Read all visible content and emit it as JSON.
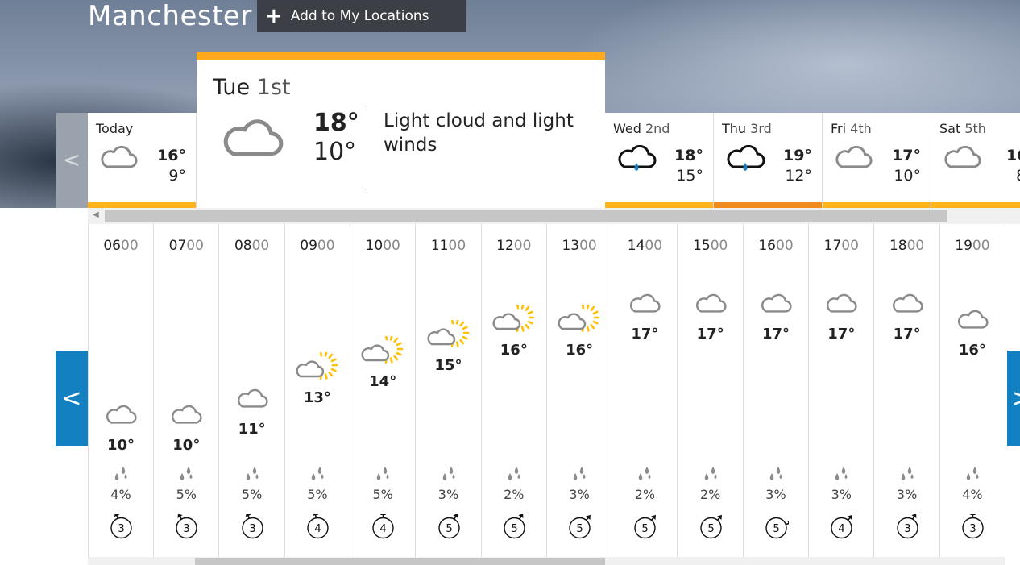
{
  "location": {
    "name": "Manchester",
    "add_label": "Add to My Locations",
    "add_icon": "plus-icon"
  },
  "colors": {
    "accent": "#ffb41e",
    "accent_dark": "#f08c1e",
    "nav": "#1380c2",
    "sun": "#ffc107",
    "rain": "#1c7bbf"
  },
  "selected_day": {
    "day": "Tue",
    "date": "1st",
    "high": "18°",
    "low": "10°",
    "description": "Light cloud and light winds",
    "icon": "cloud-icon"
  },
  "days": [
    {
      "day": "Today",
      "date": "",
      "high": "16°",
      "low": "9°",
      "icon": "cloud-icon"
    },
    {
      "day": "Wed",
      "date": "2nd",
      "high": "18°",
      "low": "15°",
      "icon": "rain-cloud-icon"
    },
    {
      "day": "Thu",
      "date": "3rd",
      "high": "19°",
      "low": "12°",
      "icon": "rain-cloud-icon"
    },
    {
      "day": "Fri",
      "date": "4th",
      "high": "17°",
      "low": "10°",
      "icon": "cloud-icon"
    },
    {
      "day": "Sat",
      "date": "5th",
      "high": "16",
      "low": "8",
      "icon": "cloud-icon"
    }
  ],
  "hours": [
    {
      "hh": "06",
      "mm": "00",
      "icon": "cloud-icon",
      "temp": "10°",
      "rain": "4%",
      "wind": "3",
      "wind_deg": 340
    },
    {
      "hh": "07",
      "mm": "00",
      "icon": "cloud-icon",
      "temp": "10°",
      "rain": "5%",
      "wind": "3",
      "wind_deg": 330
    },
    {
      "hh": "08",
      "mm": "00",
      "icon": "cloud-icon",
      "temp": "11°",
      "rain": "5%",
      "wind": "3",
      "wind_deg": 340
    },
    {
      "hh": "09",
      "mm": "00",
      "icon": "sun-cloud-icon",
      "temp": "13°",
      "rain": "5%",
      "wind": "4",
      "wind_deg": 350
    },
    {
      "hh": "10",
      "mm": "00",
      "icon": "sun-cloud-icon",
      "temp": "14°",
      "rain": "5%",
      "wind": "4",
      "wind_deg": 0
    },
    {
      "hh": "11",
      "mm": "00",
      "icon": "sun-cloud-icon",
      "temp": "15°",
      "rain": "3%",
      "wind": "5",
      "wind_deg": 30
    },
    {
      "hh": "12",
      "mm": "00",
      "icon": "sun-cloud-icon",
      "temp": "16°",
      "rain": "2%",
      "wind": "5",
      "wind_deg": 30
    },
    {
      "hh": "13",
      "mm": "00",
      "icon": "sun-cloud-icon",
      "temp": "16°",
      "rain": "3%",
      "wind": "5",
      "wind_deg": 40
    },
    {
      "hh": "14",
      "mm": "00",
      "icon": "cloud-icon",
      "temp": "17°",
      "rain": "2%",
      "wind": "5",
      "wind_deg": 40
    },
    {
      "hh": "15",
      "mm": "00",
      "icon": "cloud-icon",
      "temp": "17°",
      "rain": "2%",
      "wind": "5",
      "wind_deg": 40
    },
    {
      "hh": "16",
      "mm": "00",
      "icon": "cloud-icon",
      "temp": "17°",
      "rain": "3%",
      "wind": "5",
      "wind_deg": 70
    },
    {
      "hh": "17",
      "mm": "00",
      "icon": "cloud-icon",
      "temp": "17°",
      "rain": "3%",
      "wind": "4",
      "wind_deg": 40
    },
    {
      "hh": "18",
      "mm": "00",
      "icon": "cloud-icon",
      "temp": "17°",
      "rain": "3%",
      "wind": "3",
      "wind_deg": 30
    },
    {
      "hh": "19",
      "mm": "00",
      "icon": "cloud-icon",
      "temp": "16°",
      "rain": "4%",
      "wind": "3",
      "wind_deg": 0
    }
  ],
  "nav": {
    "prev": "<",
    "next": ">"
  }
}
